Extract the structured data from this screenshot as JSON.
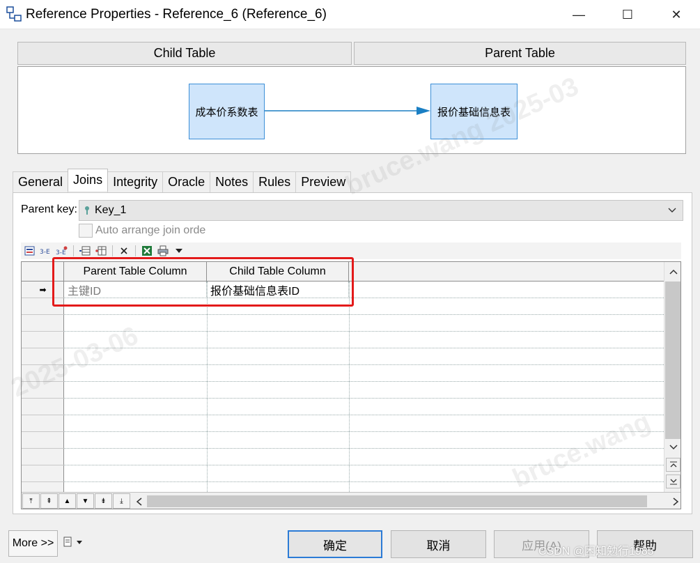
{
  "window": {
    "title": "Reference Properties - Reference_6 (Reference_6)",
    "minimize_glyph": "—",
    "maximize_glyph": "☐",
    "close_glyph": "✕"
  },
  "diagram": {
    "child_table_header": "Child Table",
    "parent_table_header": "Parent Table",
    "child_entity": "成本价系数表",
    "parent_entity": "报价基础信息表",
    "accent_color": "#1a7fc4"
  },
  "tabs": [
    {
      "label": "General",
      "active": false
    },
    {
      "label": "Joins",
      "active": true
    },
    {
      "label": "Integrity",
      "active": false
    },
    {
      "label": "Oracle",
      "active": false
    },
    {
      "label": "Notes",
      "active": false
    },
    {
      "label": "Rules",
      "active": false
    },
    {
      "label": "Preview",
      "active": false
    }
  ],
  "joins": {
    "parent_key_label": "Parent key:",
    "parent_key_value": "Key_1",
    "auto_arrange_label": "Auto arrange join orde",
    "auto_arrange_checked": false,
    "toolbar_icons": [
      "properties-icon",
      "add-row-icon",
      "insert-row-icon",
      "reuse-columns-icon",
      "migrate-columns-icon",
      "delete-icon",
      "excel-export-icon",
      "print-icon",
      "dropdown-arrow-icon"
    ],
    "columns": [
      "Parent Table Column",
      "Child Table Column"
    ],
    "rows": [
      {
        "parent": "主键ID",
        "child": "报价基础信息表ID",
        "current": true
      }
    ],
    "current_row_glyph": "➡",
    "nav_buttons": [
      "⤒",
      "⇞",
      "▲",
      "▼",
      "⇟",
      "⤓"
    ]
  },
  "buttons": {
    "more": "More >>",
    "ok": "确定",
    "cancel": "取消",
    "apply": "应用(A)",
    "help": "帮助"
  },
  "watermark": {
    "text_1": "bruce.wang 2025-03",
    "text_2": "2025-03-06",
    "text_3": "bruce.wang",
    "credit": "CSDN @困知勉行1985"
  }
}
